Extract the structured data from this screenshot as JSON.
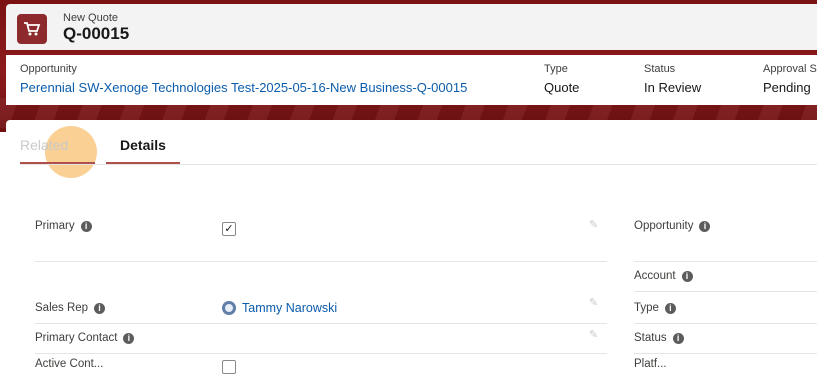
{
  "header": {
    "object_label": "New Quote",
    "record_name": "Q-00015",
    "icon": "shopping-cart-icon"
  },
  "highlights": {
    "opportunity": {
      "label": "Opportunity",
      "value": "Perennial SW-Xenoge Technologies Test-2025-05-16-New Business-Q-00015"
    },
    "type": {
      "label": "Type",
      "value": "Quote"
    },
    "status": {
      "label": "Status",
      "value": "In Review"
    },
    "approval": {
      "label": "Approval S",
      "value": "Pending"
    }
  },
  "tabs": [
    {
      "label": "Related",
      "active": false
    },
    {
      "label": "Details",
      "active": true
    }
  ],
  "details": {
    "left": {
      "primary": {
        "label": "Primary",
        "checked": true
      },
      "sales_rep": {
        "label": "Sales Rep",
        "value": "Tammy Narowski"
      },
      "primary_contact": {
        "label": "Primary Contact",
        "value": ""
      },
      "active_contract": {
        "label": "Active Cont..."
      }
    },
    "right": {
      "opportunity": {
        "label": "Opportunity"
      },
      "account": {
        "label": "Account"
      },
      "type": {
        "label": "Type"
      },
      "status": {
        "label": "Status"
      },
      "platform": {
        "label": "Platf..."
      }
    }
  },
  "colors": {
    "brand_band": "#8c1a1c",
    "icon_bg": "#8c2a2e",
    "link": "#0b5cab",
    "tab_underline": "#b0504c"
  }
}
